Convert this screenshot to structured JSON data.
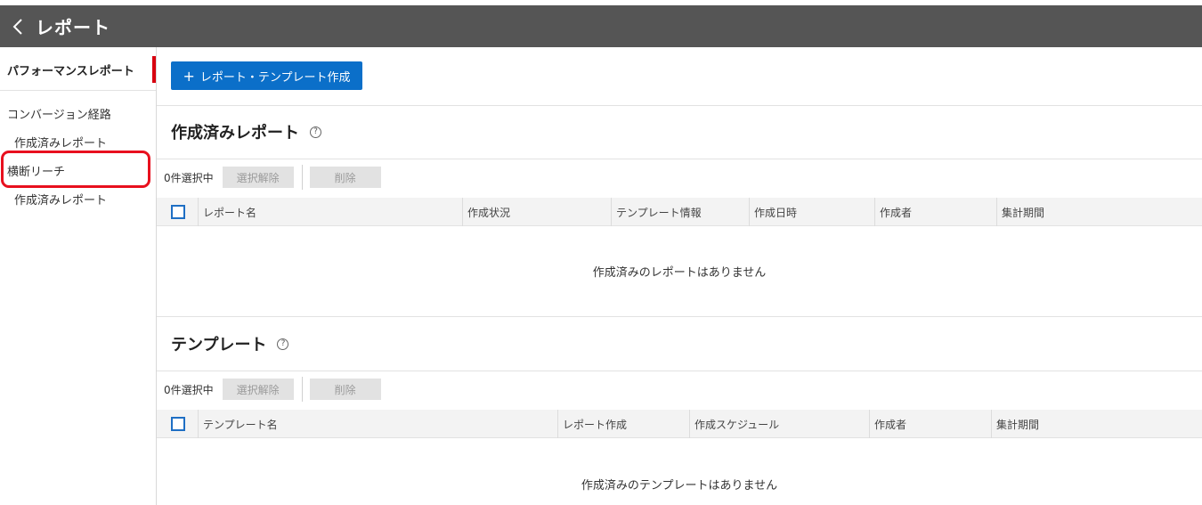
{
  "header": {
    "title": "レポート"
  },
  "sidebar": {
    "active_label": "パフォーマンスレポート",
    "items": [
      {
        "label": "コンバージョン経路"
      },
      {
        "label": "作成済みレポート"
      },
      {
        "label": "横断リーチ"
      },
      {
        "label": "作成済みレポート"
      }
    ]
  },
  "main": {
    "create_button_label": "レポート・テンプレート作成",
    "reports": {
      "title": "作成済みレポート",
      "selected_count": "0件選択中",
      "clear_label": "選択解除",
      "delete_label": "削除",
      "columns": [
        "レポート名",
        "作成状況",
        "テンプレート情報",
        "作成日時",
        "作成者",
        "集計期間"
      ],
      "empty_message": "作成済みのレポートはありません"
    },
    "templates": {
      "title": "テンプレート",
      "selected_count": "0件選択中",
      "clear_label": "選択解除",
      "delete_label": "削除",
      "columns": [
        "テンプレート名",
        "レポート作成",
        "作成スケジュール",
        "作成者",
        "集計期間"
      ],
      "empty_message": "作成済みのテンプレートはありません"
    }
  },
  "colors": {
    "header_bg": "#555555",
    "primary": "#0b6fc9",
    "active_bar": "#d7000f",
    "highlight": "#e8101e"
  }
}
